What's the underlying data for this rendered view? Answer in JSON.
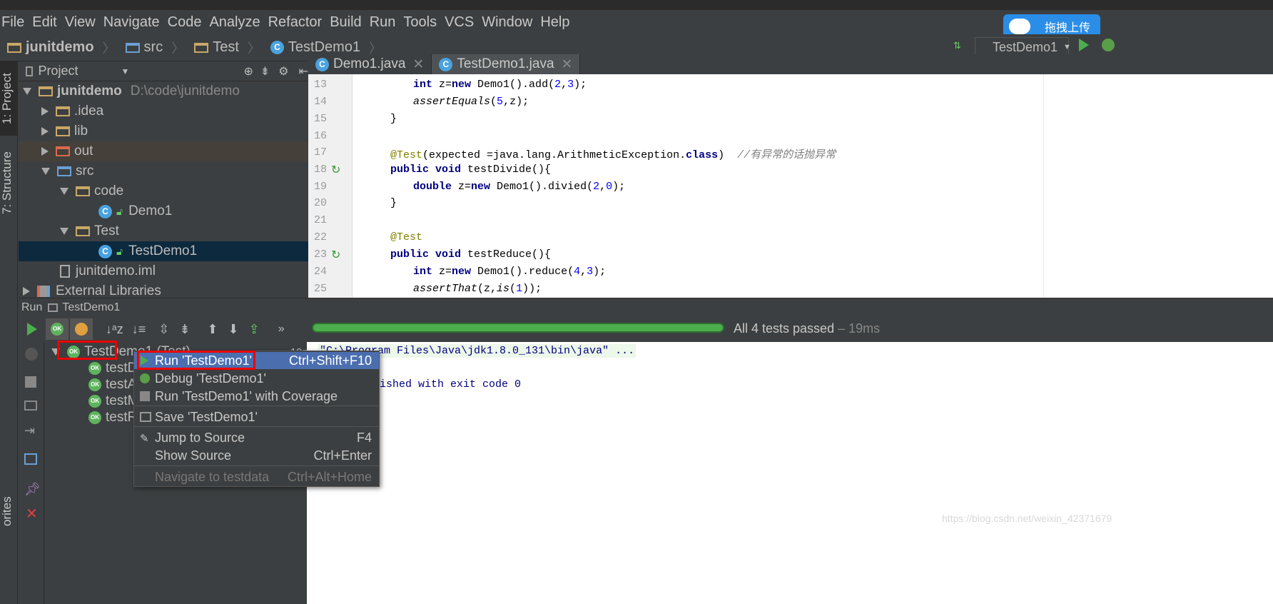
{
  "menu": [
    "File",
    "Edit",
    "View",
    "Navigate",
    "Code",
    "Analyze",
    "Refactor",
    "Build",
    "Run",
    "Tools",
    "VCS",
    "Window",
    "Help"
  ],
  "breadcrumb": [
    "junitdemo",
    "src",
    "Test",
    "TestDemo1"
  ],
  "run_config": "TestDemo1",
  "upload_button": "拖拽上传",
  "side_tabs": {
    "project": "1: Project",
    "structure": "7: Structure",
    "favorites": "orites"
  },
  "project_panel": {
    "header": "Project",
    "tree": [
      {
        "label": "junitdemo",
        "path": "D:\\code\\junitdemo",
        "expanded": true,
        "depth": 0
      },
      {
        "label": ".idea",
        "depth": 1
      },
      {
        "label": "lib",
        "depth": 1
      },
      {
        "label": "out",
        "depth": 1
      },
      {
        "label": "src",
        "depth": 1,
        "expanded": true
      },
      {
        "label": "code",
        "depth": 2,
        "expanded": true
      },
      {
        "label": "Demo1",
        "depth": 3
      },
      {
        "label": "Test",
        "depth": 2,
        "expanded": true
      },
      {
        "label": "TestDemo1",
        "depth": 3,
        "selected": true
      },
      {
        "label": "junitdemo.iml",
        "depth": 1
      },
      {
        "label": "External Libraries",
        "depth": 0
      }
    ]
  },
  "editor": {
    "tabs": [
      {
        "label": "Demo1.java",
        "active": false
      },
      {
        "label": "TestDemo1.java",
        "active": true
      }
    ],
    "line_numbers": [
      "13",
      "14",
      "15",
      "16",
      "17",
      "18",
      "19",
      "20",
      "21",
      "22",
      "23",
      "24",
      "25"
    ],
    "lines": {
      "l13a": "int",
      "l13b": " z=",
      "l13c": "new",
      "l13d": " Demo1().add(",
      "l13e": "2",
      "l13f": ",",
      "l13g": "3",
      "l13h": ");",
      "l14a": "assertEquals",
      "l14b": "(",
      "l14c": "5",
      "l14d": ",z);",
      "l15": "}",
      "l17a": "@Test",
      "l17b": "(expected =java.lang.ArithmeticException.",
      "l17c": "class",
      "l17d": ")  ",
      "l17e": "//有异常的话抛异常",
      "l18a": "public void",
      "l18b": " testDivide(){",
      "l19a": "double",
      "l19b": " z=",
      "l19c": "new",
      "l19d": " Demo1().divied(",
      "l19e": "2",
      "l19f": ",",
      "l19g": "0",
      "l19h": ");",
      "l20": "}",
      "l22": "@Test",
      "l23a": "public void",
      "l23b": " testReduce(){",
      "l24a": "int",
      "l24b": " z=",
      "l24c": "new",
      "l24d": " Demo1().reduce(",
      "l24e": "4",
      "l24f": ",",
      "l24g": "3",
      "l24h": ");",
      "l25a": "assertThat",
      "l25b": "(z,",
      "l25c": "is",
      "l25d": "(",
      "l25e": "1",
      "l25f": "));"
    }
  },
  "run_panel": {
    "title": "Run",
    "config": "TestDemo1",
    "status": "All 4 tests passed",
    "duration": " – 19ms",
    "tests": [
      "TestDemo1 (Test)",
      "testD",
      "testA",
      "testM",
      "testR"
    ],
    "root_time": "19ms",
    "console": [
      "\"C:\\Program Files\\Java\\jdk1.8.0_131\\bin\\java\" ...",
      "ished with exit code 0"
    ]
  },
  "context_menu": [
    {
      "label": "Run 'TestDemo1'",
      "shortcut": "Ctrl+Shift+F10"
    },
    {
      "label": "Debug 'TestDemo1'",
      "shortcut": ""
    },
    {
      "label": "Run 'TestDemo1' with Coverage",
      "shortcut": ""
    },
    {
      "label": "Save 'TestDemo1'",
      "shortcut": ""
    },
    {
      "label": "Jump to Source",
      "shortcut": "F4"
    },
    {
      "label": "Show Source",
      "shortcut": "Ctrl+Enter"
    },
    {
      "label": "Navigate to testdata",
      "shortcut": "Ctrl+Alt+Home"
    }
  ],
  "watermark": "https://blog.csdn.net/weixin_42371679",
  "colors": {
    "accent": "#4b6eaf",
    "highlight": "#e00000",
    "pass": "#4cae4c"
  }
}
